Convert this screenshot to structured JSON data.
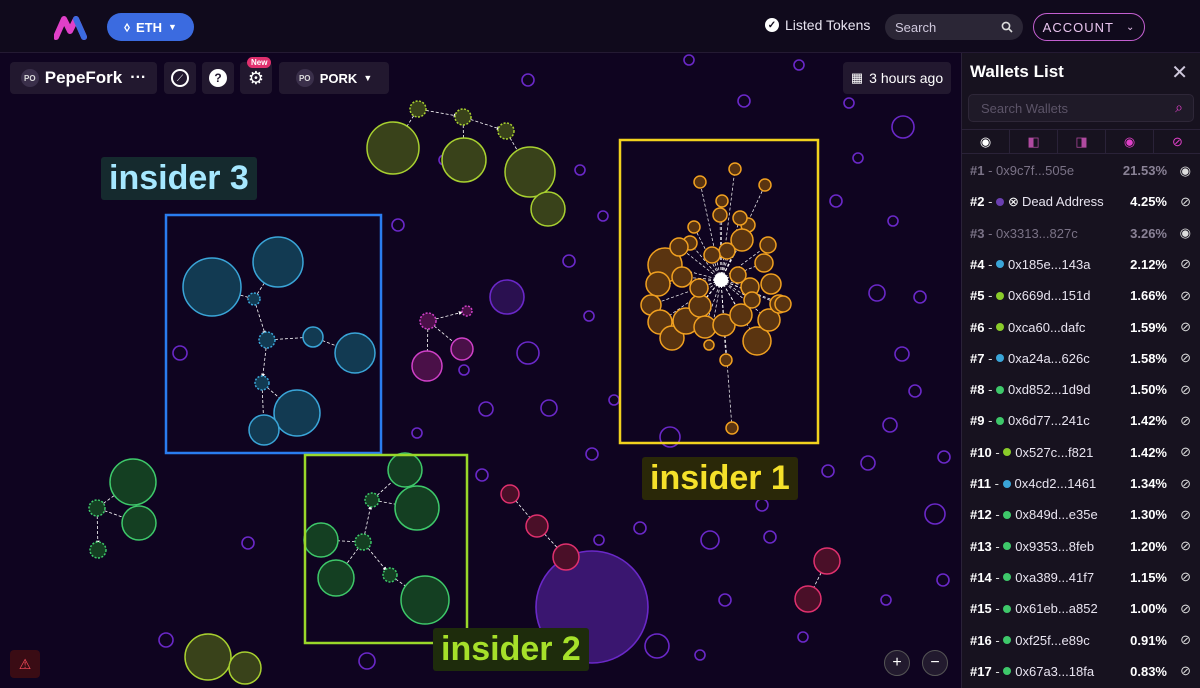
{
  "header": {
    "chain": "ETH",
    "listed_tokens": "Listed Tokens",
    "search_placeholder": "Search",
    "account": "ACCOUNT"
  },
  "toolbar": {
    "token_badge": "PO",
    "token_name": "PepeFork",
    "more": "···",
    "new_badge": "New",
    "pair_badge": "PO",
    "pair_name": "PORK",
    "time": "3 hours ago"
  },
  "annotations": {
    "insider1": "insider 1",
    "insider2": "insider 2",
    "insider3": "insider 3"
  },
  "panel": {
    "title": "Wallets List",
    "search_placeholder": "Search Wallets",
    "wallets": [
      {
        "rank": "#1",
        "address": "0x9c7f...505e",
        "pct": "21.53%",
        "color": "",
        "dimmed": true
      },
      {
        "rank": "#2",
        "address": "Dead Address",
        "pct": "4.25%",
        "color": "#6a3fb0",
        "dimmed": false
      },
      {
        "rank": "#3",
        "address": "0x3313...827c",
        "pct": "3.26%",
        "color": "",
        "dimmed": true
      },
      {
        "rank": "#4",
        "address": "0x185e...143a",
        "pct": "2.12%",
        "color": "#3aa5d8",
        "dimmed": false
      },
      {
        "rank": "#5",
        "address": "0x669d...151d",
        "pct": "1.66%",
        "color": "#8acb2a",
        "dimmed": false
      },
      {
        "rank": "#6",
        "address": "0xca60...dafc",
        "pct": "1.59%",
        "color": "#8acb2a",
        "dimmed": false
      },
      {
        "rank": "#7",
        "address": "0xa24a...626c",
        "pct": "1.58%",
        "color": "#3aa5d8",
        "dimmed": false
      },
      {
        "rank": "#8",
        "address": "0xd852...1d9d",
        "pct": "1.50%",
        "color": "#3ec86a",
        "dimmed": false
      },
      {
        "rank": "#9",
        "address": "0x6d77...241c",
        "pct": "1.42%",
        "color": "#3ec86a",
        "dimmed": false
      },
      {
        "rank": "#10",
        "address": "0x527c...f821",
        "pct": "1.42%",
        "color": "#8acb2a",
        "dimmed": false
      },
      {
        "rank": "#11",
        "address": "0x4cd2...1461",
        "pct": "1.34%",
        "color": "#3aa5d8",
        "dimmed": false
      },
      {
        "rank": "#12",
        "address": "0x849d...e35e",
        "pct": "1.30%",
        "color": "#3ec86a",
        "dimmed": false
      },
      {
        "rank": "#13",
        "address": "0x9353...8feb",
        "pct": "1.20%",
        "color": "#3ec86a",
        "dimmed": false
      },
      {
        "rank": "#14",
        "address": "0xa389...41f7",
        "pct": "1.15%",
        "color": "#3ec86a",
        "dimmed": false
      },
      {
        "rank": "#15",
        "address": "0x61eb...a852",
        "pct": "1.00%",
        "color": "#3ec86a",
        "dimmed": false
      },
      {
        "rank": "#16",
        "address": "0xf25f...e89c",
        "pct": "0.91%",
        "color": "#3ec86a",
        "dimmed": false
      },
      {
        "rank": "#17",
        "address": "0x67a3...18fa",
        "pct": "0.83%",
        "color": "#3ec86a",
        "dimmed": false
      }
    ]
  },
  "colors": {
    "accent_blue": "#3b6be0",
    "insider1_box": "#f2d21e",
    "insider2_box": "#9ad82a",
    "insider3_box": "#2a7df0",
    "cluster_orange": "#f0a020",
    "cluster_cyan": "#3aa5d8",
    "cluster_green": "#3ec86a",
    "cluster_lime": "#a8d030",
    "cluster_pink": "#e0306e",
    "cluster_magenta": "#d040c8",
    "background_bubble": "#6a28c8"
  }
}
